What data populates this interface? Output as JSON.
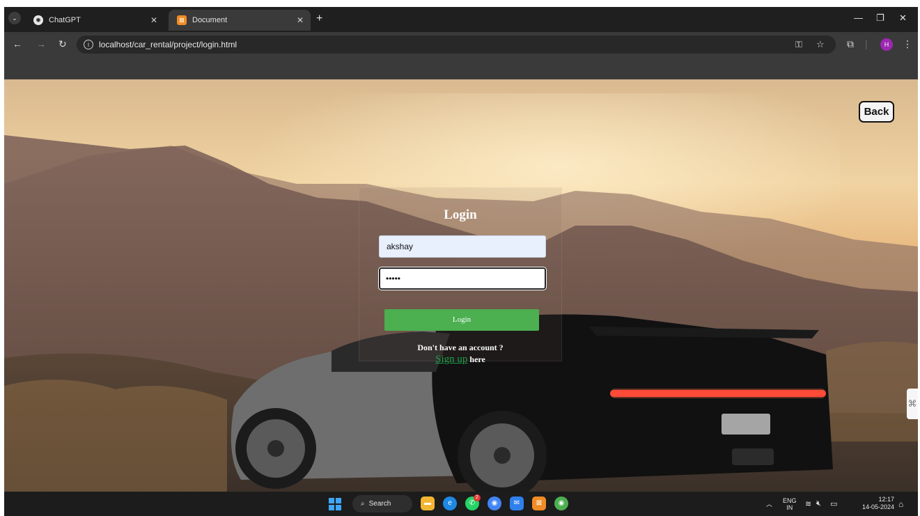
{
  "browser": {
    "tabs": [
      {
        "title": "ChatGPT",
        "favicon": "chatgpt-icon",
        "active": false
      },
      {
        "title": "Document",
        "favicon": "xampp-icon",
        "active": true
      }
    ],
    "url": "localhost/car_rental/project/login.html",
    "profile_initial": "H"
  },
  "page": {
    "back_label": "Back",
    "login": {
      "title": "Login",
      "username_value": "akshay",
      "password_value": "•••••",
      "submit_label": "Login",
      "no_account_text": "Don't have an account ?",
      "signup_link": "Sign up",
      "signup_suffix": "here"
    },
    "colors": {
      "button": "#4caf50",
      "link": "#1fa14a"
    }
  },
  "taskbar": {
    "search_label": "Search",
    "language": "ENG",
    "region": "IN",
    "time": "12:17",
    "date": "14-05-2024",
    "whatsapp_badge": "2"
  }
}
